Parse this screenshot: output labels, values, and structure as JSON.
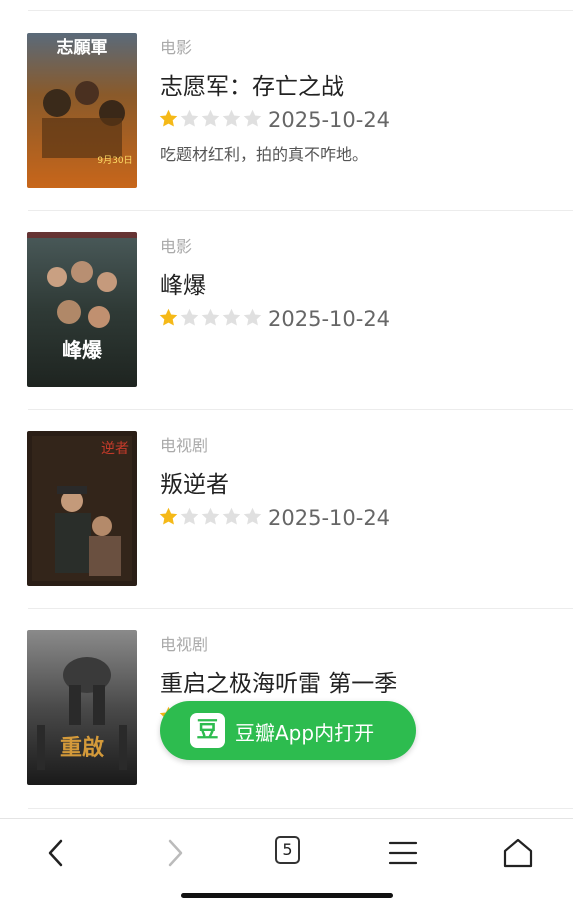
{
  "items": [
    {
      "category": "电影",
      "title": "志愿军：存亡之战",
      "rating_stars": 1,
      "date": "2025-10-24",
      "comment": "吃题材红利，拍的真不咋地。",
      "poster_text": "志願軍",
      "poster_date": "9月30日"
    },
    {
      "category": "电影",
      "title": "峰爆",
      "rating_stars": 1,
      "date": "2025-10-24",
      "comment": "",
      "poster_text": "峰爆"
    },
    {
      "category": "电视剧",
      "title": "叛逆者",
      "rating_stars": 1,
      "date": "2025-10-24",
      "comment": "",
      "poster_text": "逆者"
    },
    {
      "category": "电视剧",
      "title": "重启之极海听雷 第一季",
      "rating_stars": 1,
      "date": "",
      "comment": "",
      "poster_text": "重啟"
    }
  ],
  "open_app": {
    "logo": "豆",
    "label": "豆瓣App内打开"
  },
  "toolbar": {
    "tab_count": "5",
    "icons": [
      "back-icon",
      "forward-icon",
      "tabs-icon",
      "menu-icon",
      "home-icon"
    ]
  },
  "colors": {
    "star_filled": "#f5b918",
    "star_empty": "#e0e0e0",
    "app_green": "#2dbc4f"
  }
}
